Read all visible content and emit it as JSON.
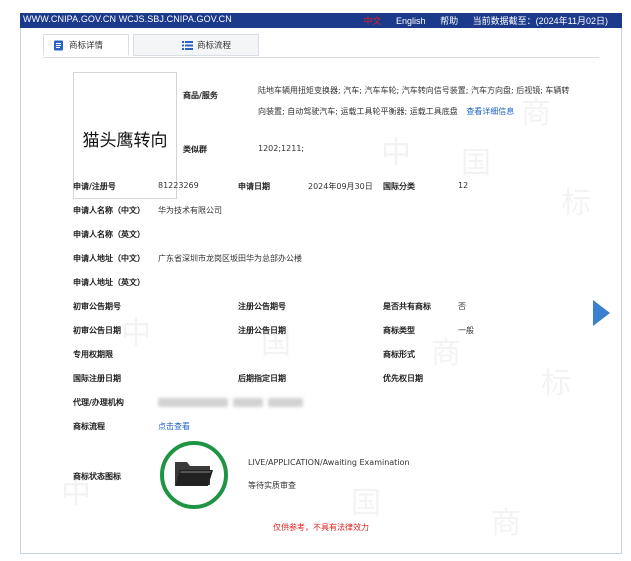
{
  "topbar": {
    "site": "WWW.CNIPA.GOV.CN WCJS.SBJ.CNIPA.GOV.CN",
    "lang_cn": "中文",
    "lang_en": "English",
    "help": "帮助",
    "data_date": "当前数据截至：(2024年11月02日)"
  },
  "tabs": [
    {
      "label": "商标详情"
    },
    {
      "label": "商标流程"
    }
  ],
  "trademark": {
    "mark_text": "猫头鹰转向",
    "goods_label": "商品/服务",
    "goods_value": "陆地车辆用扭矩变换器; 汽车; 汽车车轮; 汽车转向信号装置; 汽车方向盘; 后视镜; 车辆转向装置; 自动驾驶汽车; 运载工具轮平衡器; 运载工具底盘",
    "goods_link": "查看详细信息",
    "similar_group_label": "类似群",
    "similar_group_value": "1202;1211;"
  },
  "fields": {
    "reg_no_label": "申请/注册号",
    "reg_no_value": "81223269",
    "app_date_label": "申请日期",
    "app_date_value": "2024年09月30日",
    "intl_class_label": "国际分类",
    "intl_class_value": "12",
    "applicant_cn_label": "申请人名称（中文）",
    "applicant_cn_value": "华为技术有限公司",
    "applicant_en_label": "申请人名称（英文）",
    "address_cn_label": "申请人地址（中文）",
    "address_cn_value": "广东省深圳市龙岗区坂田华为总部办公楼",
    "address_en_label": "申请人地址（英文）",
    "prelim_no_label": "初审公告期号",
    "reg_pub_no_label": "注册公告期号",
    "shared_label": "是否共有商标",
    "shared_value": "否",
    "prelim_date_label": "初审公告日期",
    "reg_pub_date_label": "注册公告日期",
    "mark_type_label": "商标类型",
    "mark_type_value": "一般",
    "exclusive_label": "专用权期限",
    "mark_form_label": "商标形式",
    "intl_reg_date_label": "国际注册日期",
    "later_date_label": "后期指定日期",
    "priority_label": "优先权日期",
    "agent_label": "代理/办理机构",
    "process_label": "商标流程",
    "process_link": "点击查看",
    "status_label": "商标状态图标",
    "status_en": "LIVE/APPLICATION/Awaiting Examination",
    "status_cn": "等待实质审查"
  },
  "disclaimer": "仅供参考，不具有法律效力",
  "watermark_chars": [
    "中",
    "国",
    "商",
    "标"
  ],
  "colors": {
    "topbar": "#1b3a8c",
    "link": "#1a5fc8",
    "status_ring": "#1e9444",
    "disclaimer": "#e02020",
    "arrow": "#3a7fd0"
  },
  "icons": {
    "tab1": "document-icon",
    "tab2": "list-icon",
    "status": "folder-icon",
    "next": "next-arrow-icon"
  }
}
